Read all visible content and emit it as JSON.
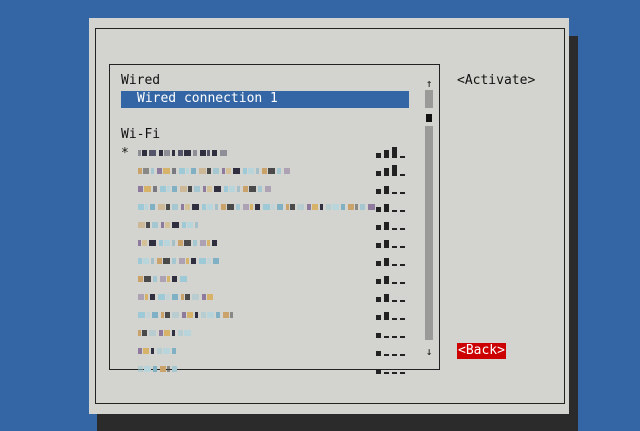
{
  "list": {
    "wired_header": "Wired",
    "wired_item": "Wired connection 1",
    "wifi_header": "Wi-Fi",
    "active_marker": "*",
    "networks": [
      {
        "ssid_obscured": true,
        "signal_bars": 3
      },
      {
        "ssid_obscured": true,
        "signal_bars": 3
      },
      {
        "ssid_obscured": true,
        "signal_bars": 2
      },
      {
        "ssid_obscured": true,
        "signal_bars": 2
      },
      {
        "ssid_obscured": true,
        "signal_bars": 2
      },
      {
        "ssid_obscured": true,
        "signal_bars": 2
      },
      {
        "ssid_obscured": true,
        "signal_bars": 2
      },
      {
        "ssid_obscured": true,
        "signal_bars": 2
      },
      {
        "ssid_obscured": true,
        "signal_bars": 2
      },
      {
        "ssid_obscured": true,
        "signal_bars": 2
      },
      {
        "ssid_obscured": true,
        "signal_bars": 1
      },
      {
        "ssid_obscured": true,
        "signal_bars": 1
      },
      {
        "ssid_obscured": true,
        "signal_bars": 1
      }
    ]
  },
  "scrollbar": {
    "up_arrow": "↑",
    "down_arrow": "↓"
  },
  "buttons": {
    "activate": "<Activate>",
    "back": "<Back>"
  },
  "colors": {
    "background": "#3465a4",
    "dialog": "#d3d3cf",
    "selection": "#3465a4",
    "back_button": "#cc0000"
  }
}
